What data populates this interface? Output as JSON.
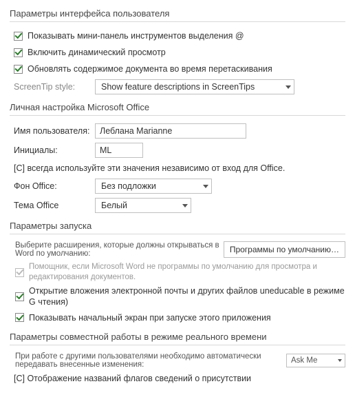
{
  "sections": {
    "ui_options": {
      "title": "Параметры интерфейса пользователя",
      "cb_mini_toolbar": "Показывать мини-панель инструментов выделения @",
      "cb_live_preview": "Включить динамический просмотр",
      "cb_update_drag": "Обновлять содержимое документа во время перетаскивания",
      "screentip_label": "ScreenTip style:",
      "screentip_value": "Show feature descriptions in ScreenTips"
    },
    "personalize": {
      "title": "Личная настройка Microsoft Office",
      "username_label": "Имя пользователя:",
      "username_value": "Леблана Marianne",
      "initials_label": "Инициалы:",
      "initials_value": "ML",
      "always_use": "[C] всегда используйте эти значения независимо от вход для Office.",
      "bg_label": "Фон Office:",
      "bg_value": "Без подложки",
      "theme_label": "Тема Office",
      "theme_value": "Белый"
    },
    "startup": {
      "title": "Параметры запуска",
      "ext_line": "Выберите расширения, которые должны открываться в Word по умолчанию:",
      "ext_button": "Программы по умолчанию…",
      "cb_assistant": "Помощник, если Microsoft Word не программы по умолчанию для просмотра и редактирования документов.",
      "cb_open_attach": "Открытие вложения электронной почты и других файлов uneducable в режиме G чтения)",
      "cb_start_screen": "Показывать начальный экран при запуске этого приложения"
    },
    "collab": {
      "title": "Параметры совместной работы в режиме реального времени",
      "share_line": "При работе с другими пользователями необходимо автоматически передавать внесенные изменения:",
      "share_value": "Ask Me",
      "flags": "[C] Отображение названий флагов сведений о присутствии"
    }
  }
}
